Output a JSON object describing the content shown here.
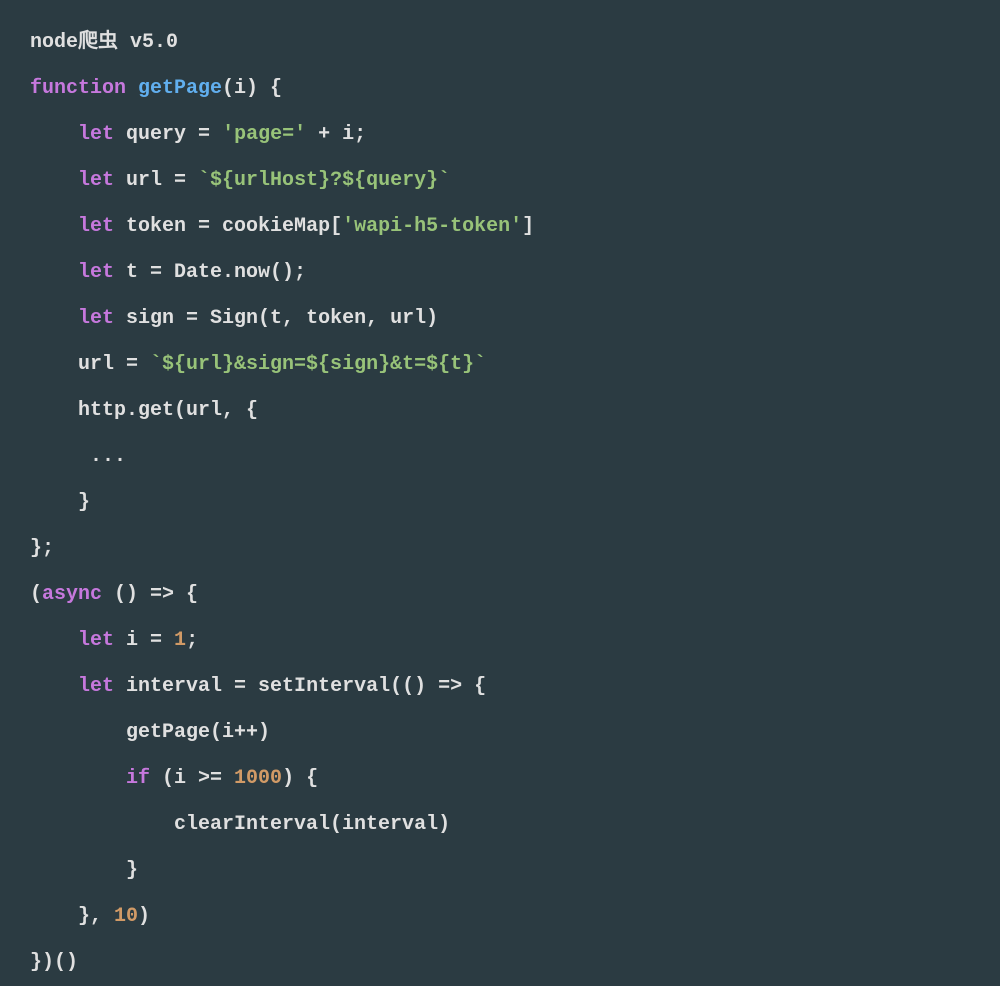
{
  "code": {
    "title": "node爬虫 v5.0",
    "lines": {
      "l1": "node爬虫 v5.0",
      "l2": "function getPage(i) {",
      "l3": "    let query = 'page=' + i;",
      "l4": "    let url = `${urlHost}?${query}`",
      "l5": "    let token = cookieMap['wapi-h5-token']",
      "l6": "    let t = Date.now();",
      "l7": "    let sign = Sign(t, token, url)",
      "l8": "    url = `${url}&sign=${sign}&t=${t}`",
      "l9": "    http.get(url, {",
      "l10": "     ...",
      "l11": "    }",
      "l12": "};",
      "l13": "(async () => {",
      "l14": "    let i = 1;",
      "l15": "    let interval = setInterval(() => {",
      "l16": "        getPage(i++)",
      "l17": "        if (i >= 1000) {",
      "l18": "            clearInterval(interval)",
      "l19": "        }",
      "l20": "    }, 10)",
      "l21": "})()"
    },
    "tokens": {
      "function": "function",
      "let": "let",
      "async": "async",
      "if": "if",
      "getPage": "getPage",
      "query": "query",
      "url": "url",
      "token": "token",
      "t": "t",
      "sign": "sign",
      "i": "i",
      "interval": "interval",
      "cookieMap": "cookieMap",
      "urlHost": "urlHost",
      "Date": "Date",
      "now": "now",
      "Sign": "Sign",
      "http": "http",
      "get": "get",
      "setInterval": "setInterval",
      "clearInterval": "clearInterval",
      "page_str": "'page='",
      "wapi_str": "'wapi-h5-token'",
      "num1": "1",
      "num1000": "1000",
      "num10": "10"
    }
  }
}
